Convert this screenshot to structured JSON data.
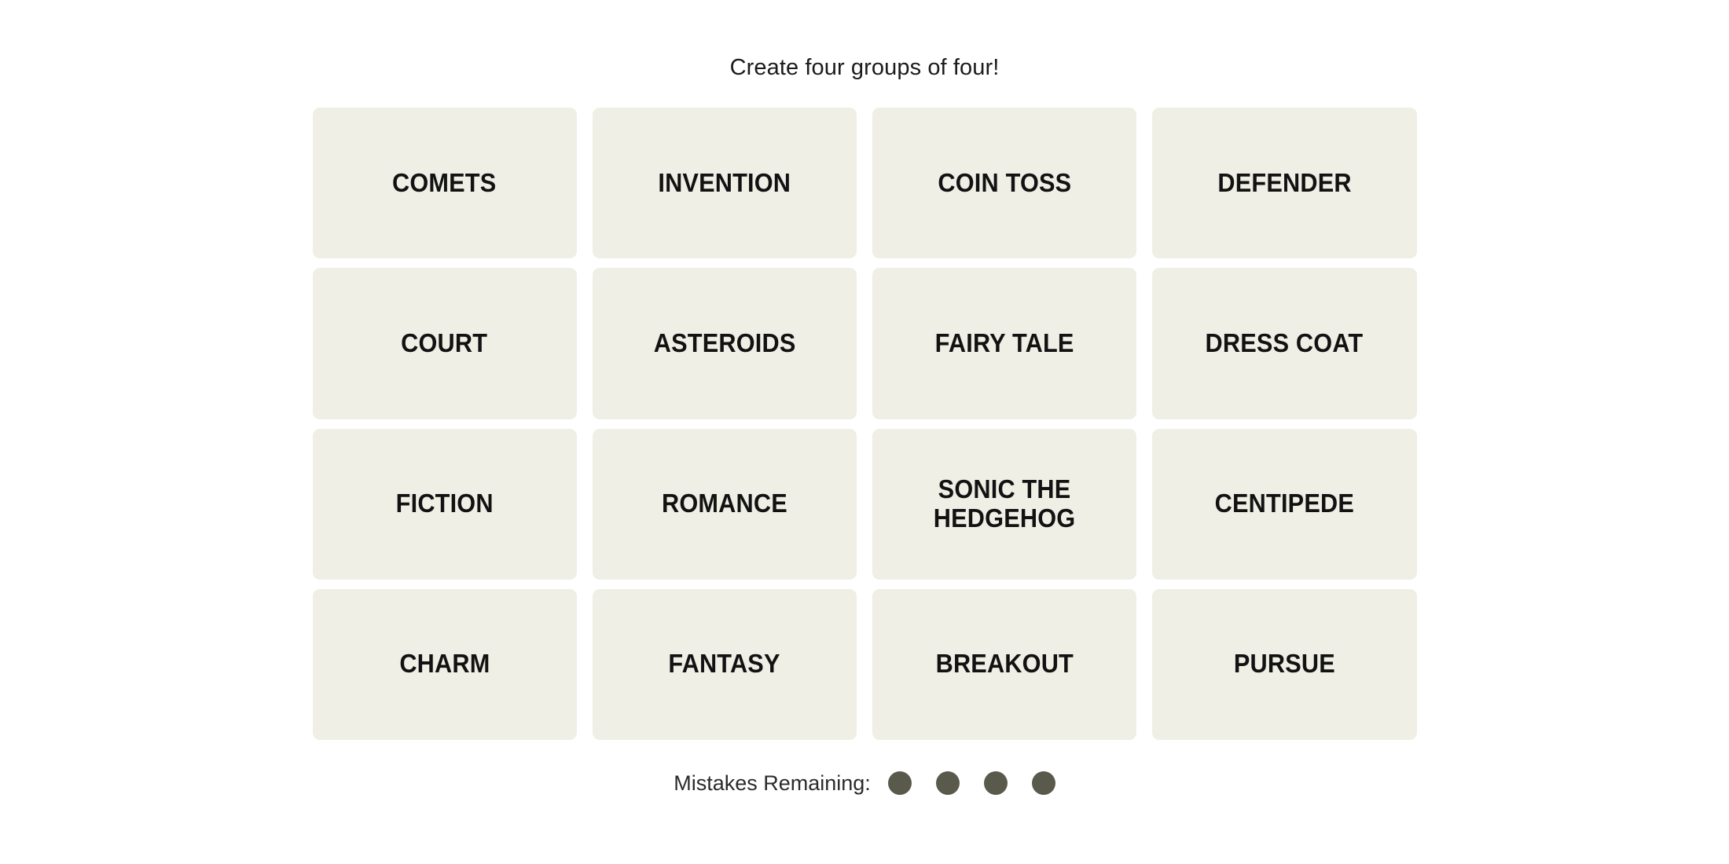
{
  "game": {
    "instruction": "Create four groups of four!"
  },
  "board": {
    "rows": 4,
    "columns": 4,
    "tiles": [
      {
        "label": "COMETS"
      },
      {
        "label": "INVENTION"
      },
      {
        "label": "COIN TOSS"
      },
      {
        "label": "DEFENDER"
      },
      {
        "label": "COURT"
      },
      {
        "label": "ASTEROIDS"
      },
      {
        "label": "FAIRY TALE"
      },
      {
        "label": "DRESS COAT"
      },
      {
        "label": "FICTION"
      },
      {
        "label": "ROMANCE"
      },
      {
        "label": "SONIC THE\nHEDGEHOG"
      },
      {
        "label": "CENTIPEDE"
      },
      {
        "label": "CHARM"
      },
      {
        "label": "FANTASY"
      },
      {
        "label": "BREAKOUT"
      },
      {
        "label": "PURSUE"
      }
    ]
  },
  "mistakes": {
    "label": "Mistakes Remaining:",
    "remaining": 4,
    "dots": [
      {
        "state": "filled"
      },
      {
        "state": "filled"
      },
      {
        "state": "filled"
      },
      {
        "state": "filled"
      }
    ]
  },
  "colors": {
    "page_background": "#FFFFFF",
    "tile_background": "#EFEFE6",
    "tile_text": "#121212",
    "instruction_text": "#1B1B1B",
    "mistake_dot": "#5A5A4C",
    "mistakes_label_text": "#2B2B2B"
  }
}
